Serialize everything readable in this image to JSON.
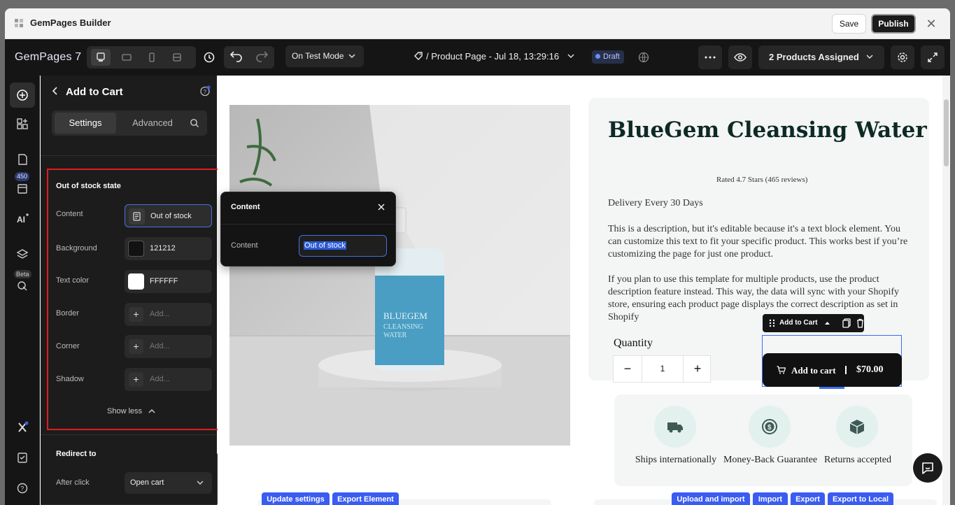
{
  "app": {
    "window_title": "GemPages Builder",
    "save_label": "Save",
    "publish_label": "Publish",
    "logo": "GemPages 7"
  },
  "topbar": {
    "test_mode": "On Test Mode",
    "page_title": "/ Product Page - Jul 18, 13:29:16",
    "status": "Draft",
    "products_assigned": "2 Products Assigned"
  },
  "rail": {
    "badge": "450",
    "beta": "Beta"
  },
  "panel": {
    "title": "Add to Cart",
    "tabs": [
      "Settings",
      "Advanced"
    ],
    "section_title": "Out of stock state",
    "rows": {
      "content": {
        "label": "Content",
        "value": "Out of stock"
      },
      "background": {
        "label": "Background",
        "value": "121212",
        "color": "#121212"
      },
      "text_color": {
        "label": "Text color",
        "value": "FFFFFF",
        "color": "#FFFFFF"
      },
      "border": {
        "label": "Border",
        "placeholder": "Add..."
      },
      "corner": {
        "label": "Corner",
        "placeholder": "Add..."
      },
      "shadow": {
        "label": "Shadow",
        "placeholder": "Add..."
      }
    },
    "show_less": "Show less",
    "redirect_title": "Redirect to",
    "after_click_label": "After click",
    "after_click_value": "Open cart"
  },
  "popover": {
    "title": "Content",
    "label": "Content",
    "value": "Out of stock"
  },
  "product": {
    "title": "BlueGem Cleansing Water",
    "rating": "Rated 4.7 Stars (465 reviews)",
    "delivery": "Delivery Every 30 Days",
    "desc1": "This is a description, but it's editable because it's a text block element. You can customize this text to fit your specific product. This works best if you’re customizing the page for just one product.",
    "desc2": "If you plan to use this template for multiple products, use the product description feature instead. This way, the data will sync with your Shopify store, ensuring each product page displays the correct description as set in Shopify",
    "quantity_label": "Quantity",
    "quantity_value": "1",
    "element_toolbar_label": "Add to Cart",
    "add_to_cart": "Add to cart",
    "price": "$70.00",
    "bottle_brand": "BLUEGEM",
    "bottle_line1": "CLEANSING",
    "bottle_line2": "WATER"
  },
  "benefits": [
    {
      "label": "Ships internationally",
      "icon": "truck-icon"
    },
    {
      "label": "Money-Back Guarantee",
      "icon": "money-back-icon"
    },
    {
      "label": "Returns accepted",
      "icon": "box-icon"
    }
  ],
  "bottom_actions": {
    "update_settings": "Update settings",
    "export_element": "Export Element",
    "upload_import": "Upload and import",
    "import": "Import",
    "export": "Export",
    "export_local": "Export to Local"
  },
  "colors": {
    "accent": "#3a5cf2",
    "highlight_red": "#e21b1b",
    "dark_bg": "#151515"
  }
}
